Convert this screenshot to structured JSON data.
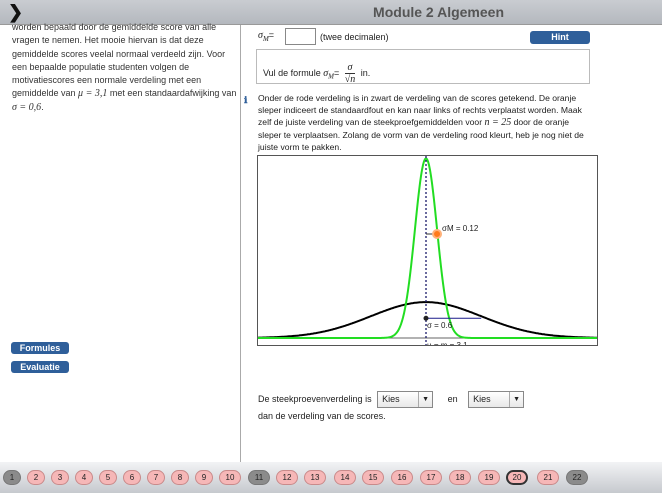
{
  "header": {
    "title": "Module 2 Algemeen",
    "nav_icon": "chevron-right-icon"
  },
  "left": {
    "text_1": "worden bepaald door de gemiddelde score van alle vragen te nemen. Het mooie hiervan is dat deze gemiddelde scores veelal normaal verdeeld zijn. Voor een bepaalde populatie studenten volgen de motivatiescores een normale verdeling met een gemiddelde van ",
    "mu": "μ = 3,1",
    "text_2": " met een standaardafwijking van ",
    "sigma": "σ = 0,6",
    "text_3": ".",
    "formules": "Formules",
    "evaluatie": "Evaluatie"
  },
  "answer": {
    "label": "σ",
    "sub": "M",
    "eq": "=",
    "value": "",
    "note": "(twee decimalen)",
    "hint": "Hint"
  },
  "formula": {
    "prefix": "Vul de formule ",
    "lhs": "σ",
    "sub": "M",
    "eq": "=",
    "num": "σ",
    "den": "√n",
    "suffix": " in."
  },
  "instruction": {
    "text_1": "Onder de rode verdeling is in zwart de verdeling van de scores getekend. De oranje sleper indiceert de standaardfout en kan naar links of rechts verplaatst worden. Maak zelf de juiste verdeling van de steekproefgemiddelden voor ",
    "n": "n = 25",
    "text_2": " door de oranje sleper te verplaatsen. Zolang de vorm van de verdeling rood kleurt, heb je nog niet de juiste vorm te pakken."
  },
  "plot": {
    "mu": 3.1,
    "sigma": 0.6,
    "sigma_m": 0.12,
    "label_sigma_m": "σM = 0.12",
    "label_sigma": "σ = 0.6",
    "label_mu": "μ = m = 3.1",
    "colors": {
      "sample": "#22dd22",
      "population": "#000000",
      "handle": "#ff7a1a",
      "sigma_line": "#1a1a8a"
    }
  },
  "dropdowns": {
    "prefix": "De steekproevenverdeling is",
    "first": "Kies",
    "middle": "en",
    "second": "Kies",
    "suffix": "dan de verdeling van de scores."
  },
  "pages": [
    {
      "n": "1",
      "s": "gray"
    },
    {
      "n": "2",
      "s": "pink"
    },
    {
      "n": "3",
      "s": "pink"
    },
    {
      "n": "4",
      "s": "pink"
    },
    {
      "n": "5",
      "s": "pink"
    },
    {
      "n": "6",
      "s": "pink"
    },
    {
      "n": "7",
      "s": "pink"
    },
    {
      "n": "8",
      "s": "pink"
    },
    {
      "n": "9",
      "s": "pink"
    },
    {
      "n": "10",
      "s": "pink"
    },
    {
      "n": "11",
      "s": "gray"
    },
    {
      "n": "12",
      "s": "pink"
    },
    {
      "n": "13",
      "s": "pink"
    },
    {
      "n": "14",
      "s": "pink"
    },
    {
      "n": "15",
      "s": "pink"
    },
    {
      "n": "16",
      "s": "pink"
    },
    {
      "n": "17",
      "s": "pink"
    },
    {
      "n": "18",
      "s": "pink"
    },
    {
      "n": "19",
      "s": "pink"
    },
    {
      "n": "20",
      "s": "current"
    },
    {
      "n": "21",
      "s": "pink"
    },
    {
      "n": "22",
      "s": "gray"
    }
  ]
}
